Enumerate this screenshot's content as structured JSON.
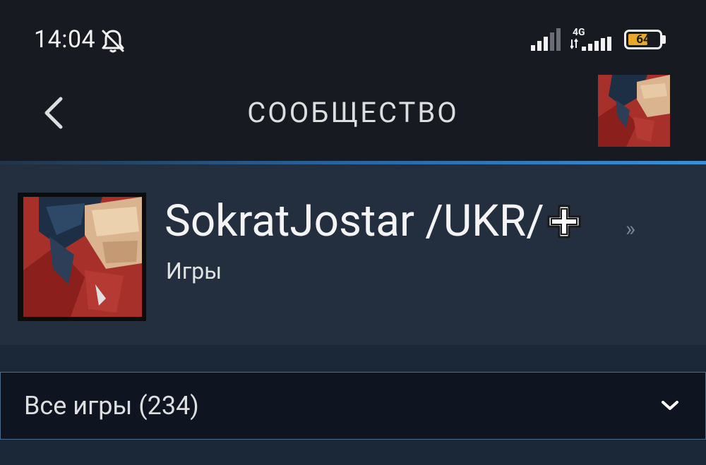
{
  "status_bar": {
    "time": "14:04",
    "network_type": "4G",
    "battery_level": "64",
    "battery_fraction": 0.64,
    "icons": [
      "bell-off-icon",
      "signal-icon",
      "signal-4g-icon",
      "battery-icon"
    ]
  },
  "app_bar": {
    "title": "СООБЩЕСТВО",
    "back_icon": "chevron-left-icon"
  },
  "profile": {
    "name": "SokratJostar /UKR/",
    "name_suffix_icon": "plus-icon",
    "more_indicator": "»",
    "subtitle": "Игры"
  },
  "games_filter": {
    "selected": "Все игры (234)",
    "icon": "chevron-down-icon"
  },
  "colors": {
    "bar_bg": "#171a21",
    "header_bg": "#232e3e",
    "page_bg": "#1b2838",
    "select_bg": "#0e1420",
    "accent_blue": "#3b8fd6",
    "battery": "#e8a92a"
  }
}
